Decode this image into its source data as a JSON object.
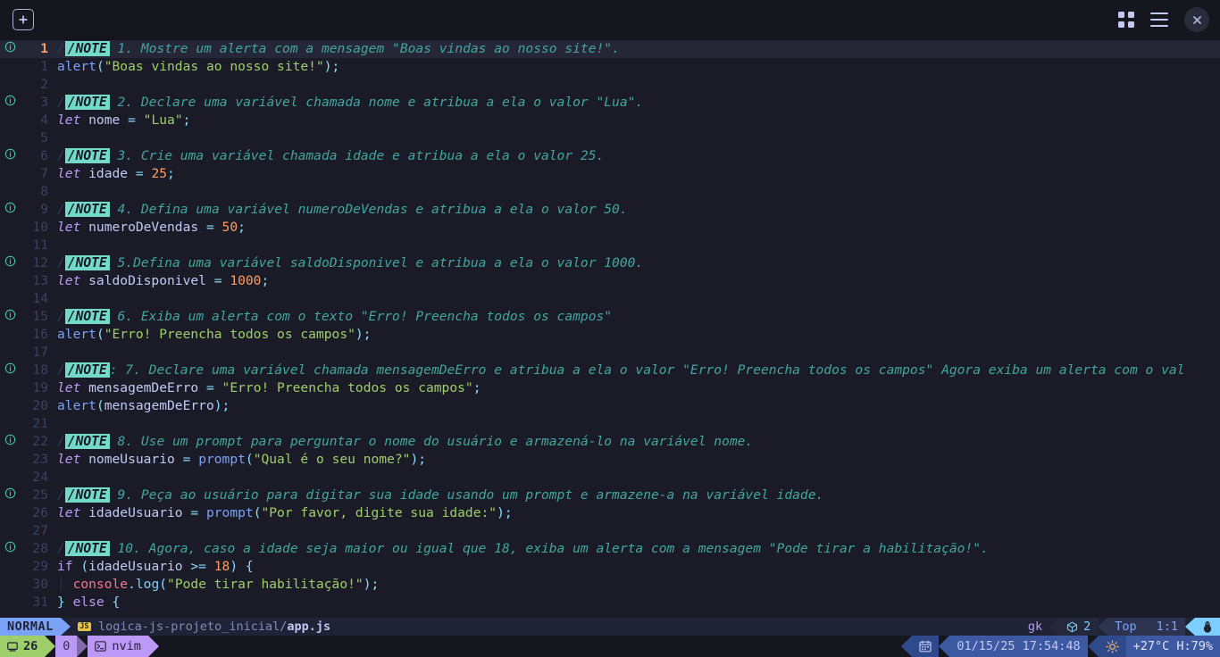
{
  "window": {
    "titlebar": {
      "new_tab_label": "+",
      "new_tab_icon": "plus-square-icon",
      "grid_icon": "grid-view-icon",
      "menu_icon": "hamburger-menu-icon",
      "close_icon": "close-x-icon"
    }
  },
  "editor": {
    "note_badge_label": "/NOTE",
    "cursor_line": 1,
    "lines": [
      {
        "num": "1",
        "sign": "info",
        "cursor": true,
        "tokens": [
          {
            "c": "t-note-slash",
            "t": "/"
          },
          {
            "c": "t-note-badge",
            "t": "/NOTE"
          },
          {
            "c": "t-comment",
            "t": " 1. Mostre um alerta com a mensagem \"Boas vindas ao nosso site!\"."
          }
        ]
      },
      {
        "num": "1",
        "sign": "",
        "cursor": false,
        "tokens": [
          {
            "c": "t-fn",
            "t": "alert"
          },
          {
            "c": "t-punct",
            "t": "("
          },
          {
            "c": "t-str",
            "t": "\"Boas vindas ao nosso site!\""
          },
          {
            "c": "t-punct",
            "t": ");"
          }
        ]
      },
      {
        "num": "2",
        "sign": "",
        "cursor": false,
        "tokens": []
      },
      {
        "num": "3",
        "sign": "info",
        "cursor": false,
        "tokens": [
          {
            "c": "t-note-slash",
            "t": "/"
          },
          {
            "c": "t-note-badge",
            "t": "/NOTE"
          },
          {
            "c": "t-comment",
            "t": " 2. Declare uma variável chamada nome e atribua a ela o valor \"Lua\"."
          }
        ]
      },
      {
        "num": "4",
        "sign": "",
        "cursor": false,
        "tokens": [
          {
            "c": "t-kw",
            "t": "let"
          },
          {
            "c": "t-ident",
            "t": " nome "
          },
          {
            "c": "t-op",
            "t": "="
          },
          {
            "c": "t-ident",
            "t": " "
          },
          {
            "c": "t-str",
            "t": "\"Lua\""
          },
          {
            "c": "t-punct",
            "t": ";"
          }
        ]
      },
      {
        "num": "5",
        "sign": "",
        "cursor": false,
        "tokens": []
      },
      {
        "num": "6",
        "sign": "info",
        "cursor": false,
        "tokens": [
          {
            "c": "t-note-slash",
            "t": "/"
          },
          {
            "c": "t-note-badge",
            "t": "/NOTE"
          },
          {
            "c": "t-comment",
            "t": " 3. Crie uma variável chamada idade e atribua a ela o valor 25."
          }
        ]
      },
      {
        "num": "7",
        "sign": "",
        "cursor": false,
        "tokens": [
          {
            "c": "t-kw",
            "t": "let"
          },
          {
            "c": "t-ident",
            "t": " idade "
          },
          {
            "c": "t-op",
            "t": "="
          },
          {
            "c": "t-ident",
            "t": " "
          },
          {
            "c": "t-num",
            "t": "25"
          },
          {
            "c": "t-punct",
            "t": ";"
          }
        ]
      },
      {
        "num": "8",
        "sign": "",
        "cursor": false,
        "tokens": []
      },
      {
        "num": "9",
        "sign": "info",
        "cursor": false,
        "tokens": [
          {
            "c": "t-note-slash",
            "t": "/"
          },
          {
            "c": "t-note-badge",
            "t": "/NOTE"
          },
          {
            "c": "t-comment",
            "t": " 4. Defina uma variável numeroDeVendas e atribua a ela o valor 50."
          }
        ]
      },
      {
        "num": "10",
        "sign": "",
        "cursor": false,
        "tokens": [
          {
            "c": "t-kw",
            "t": "let"
          },
          {
            "c": "t-ident",
            "t": " numeroDeVendas "
          },
          {
            "c": "t-op",
            "t": "="
          },
          {
            "c": "t-ident",
            "t": " "
          },
          {
            "c": "t-num",
            "t": "50"
          },
          {
            "c": "t-punct",
            "t": ";"
          }
        ]
      },
      {
        "num": "11",
        "sign": "",
        "cursor": false,
        "tokens": []
      },
      {
        "num": "12",
        "sign": "info",
        "cursor": false,
        "tokens": [
          {
            "c": "t-note-slash",
            "t": "/"
          },
          {
            "c": "t-note-badge",
            "t": "/NOTE"
          },
          {
            "c": "t-comment",
            "t": " 5.Defina uma variável saldoDisponivel e atribua a ela o valor 1000."
          }
        ]
      },
      {
        "num": "13",
        "sign": "",
        "cursor": false,
        "tokens": [
          {
            "c": "t-kw",
            "t": "let"
          },
          {
            "c": "t-ident",
            "t": " saldoDisponivel "
          },
          {
            "c": "t-op",
            "t": "="
          },
          {
            "c": "t-ident",
            "t": " "
          },
          {
            "c": "t-num",
            "t": "1000"
          },
          {
            "c": "t-punct",
            "t": ";"
          }
        ]
      },
      {
        "num": "14",
        "sign": "",
        "cursor": false,
        "tokens": []
      },
      {
        "num": "15",
        "sign": "info",
        "cursor": false,
        "tokens": [
          {
            "c": "t-note-slash",
            "t": "/"
          },
          {
            "c": "t-note-badge",
            "t": "/NOTE"
          },
          {
            "c": "t-comment",
            "t": " 6. Exiba um alerta com o texto \"Erro! Preencha todos os campos\""
          }
        ]
      },
      {
        "num": "16",
        "sign": "",
        "cursor": false,
        "tokens": [
          {
            "c": "t-fn",
            "t": "alert"
          },
          {
            "c": "t-punct",
            "t": "("
          },
          {
            "c": "t-str",
            "t": "\"Erro! Preencha todos os campos\""
          },
          {
            "c": "t-punct",
            "t": ");"
          }
        ]
      },
      {
        "num": "17",
        "sign": "",
        "cursor": false,
        "tokens": []
      },
      {
        "num": "18",
        "sign": "info",
        "cursor": false,
        "tokens": [
          {
            "c": "t-note-slash",
            "t": "/"
          },
          {
            "c": "t-note-badge",
            "t": "/NOTE"
          },
          {
            "c": "t-comment",
            "t": ": 7. Declare uma variável chamada mensagemDeErro e atribua a ela o valor \"Erro! Preencha todos os campos\" Agora exiba um alerta com o val"
          }
        ]
      },
      {
        "num": "19",
        "sign": "",
        "cursor": false,
        "tokens": [
          {
            "c": "t-kw",
            "t": "let"
          },
          {
            "c": "t-ident",
            "t": " mensagemDeErro "
          },
          {
            "c": "t-op",
            "t": "="
          },
          {
            "c": "t-ident",
            "t": " "
          },
          {
            "c": "t-str",
            "t": "\"Erro! Preencha todos os campos\""
          },
          {
            "c": "t-punct",
            "t": ";"
          }
        ]
      },
      {
        "num": "20",
        "sign": "",
        "cursor": false,
        "tokens": [
          {
            "c": "t-fn",
            "t": "alert"
          },
          {
            "c": "t-punct",
            "t": "("
          },
          {
            "c": "t-ident",
            "t": "mensagemDeErro"
          },
          {
            "c": "t-punct",
            "t": ");"
          }
        ]
      },
      {
        "num": "21",
        "sign": "",
        "cursor": false,
        "tokens": []
      },
      {
        "num": "22",
        "sign": "info",
        "cursor": false,
        "tokens": [
          {
            "c": "t-note-slash",
            "t": "/"
          },
          {
            "c": "t-note-badge",
            "t": "/NOTE"
          },
          {
            "c": "t-comment",
            "t": " 8. Use um prompt para perguntar o nome do usuário e armazená-lo na variável nome."
          }
        ]
      },
      {
        "num": "23",
        "sign": "",
        "cursor": false,
        "tokens": [
          {
            "c": "t-kw",
            "t": "let"
          },
          {
            "c": "t-ident",
            "t": " nomeUsuario "
          },
          {
            "c": "t-op",
            "t": "="
          },
          {
            "c": "t-ident",
            "t": " "
          },
          {
            "c": "t-fn",
            "t": "prompt"
          },
          {
            "c": "t-punct",
            "t": "("
          },
          {
            "c": "t-str",
            "t": "\"Qual é o seu nome?\""
          },
          {
            "c": "t-punct",
            "t": ");"
          }
        ]
      },
      {
        "num": "24",
        "sign": "",
        "cursor": false,
        "tokens": []
      },
      {
        "num": "25",
        "sign": "info",
        "cursor": false,
        "tokens": [
          {
            "c": "t-note-slash",
            "t": "/"
          },
          {
            "c": "t-note-badge",
            "t": "/NOTE"
          },
          {
            "c": "t-comment",
            "t": " 9. Peça ao usuário para digitar sua idade usando um prompt e armazene-a na variável idade."
          }
        ]
      },
      {
        "num": "26",
        "sign": "",
        "cursor": false,
        "tokens": [
          {
            "c": "t-kw",
            "t": "let"
          },
          {
            "c": "t-ident",
            "t": " idadeUsuario "
          },
          {
            "c": "t-op",
            "t": "="
          },
          {
            "c": "t-ident",
            "t": " "
          },
          {
            "c": "t-fn",
            "t": "prompt"
          },
          {
            "c": "t-punct",
            "t": "("
          },
          {
            "c": "t-str",
            "t": "\"Por favor, digite sua idade:\""
          },
          {
            "c": "t-punct",
            "t": ");"
          }
        ]
      },
      {
        "num": "27",
        "sign": "",
        "cursor": false,
        "tokens": []
      },
      {
        "num": "28",
        "sign": "info",
        "cursor": false,
        "tokens": [
          {
            "c": "t-note-slash",
            "t": "/"
          },
          {
            "c": "t-note-badge",
            "t": "/NOTE"
          },
          {
            "c": "t-comment",
            "t": " 10. Agora, caso a idade seja maior ou igual que 18, exiba um alerta com a mensagem \"Pode tirar a habilitação!\"."
          }
        ]
      },
      {
        "num": "29",
        "sign": "",
        "cursor": false,
        "tokens": [
          {
            "c": "t-kw2",
            "t": "if"
          },
          {
            "c": "t-punct",
            "t": " ("
          },
          {
            "c": "t-ident",
            "t": "idadeUsuario "
          },
          {
            "c": "t-op",
            "t": ">="
          },
          {
            "c": "t-ident",
            "t": " "
          },
          {
            "c": "t-num",
            "t": "18"
          },
          {
            "c": "t-punct",
            "t": ") {"
          }
        ]
      },
      {
        "num": "30",
        "sign": "",
        "cursor": false,
        "tokens": [
          {
            "c": "t-guide",
            "t": "│ "
          },
          {
            "c": "t-obj",
            "t": "console"
          },
          {
            "c": "t-punct",
            "t": "."
          },
          {
            "c": "t-prop",
            "t": "log"
          },
          {
            "c": "t-punct",
            "t": "("
          },
          {
            "c": "t-str",
            "t": "\"Pode tirar habilitação!\""
          },
          {
            "c": "t-punct",
            "t": ");"
          }
        ]
      },
      {
        "num": "31",
        "sign": "",
        "cursor": false,
        "tokens": [
          {
            "c": "t-punct",
            "t": "} "
          },
          {
            "c": "t-kw2",
            "t": "else"
          },
          {
            "c": "t-punct",
            "t": " {"
          }
        ]
      }
    ]
  },
  "statusline": {
    "mode": "NORMAL",
    "filetype_badge": "JS",
    "file_dir": "logica-js-projeto_inicial/",
    "file_name": "app.js",
    "keys_pending": "gk",
    "git_icon": "cube-icon",
    "git_count": "2",
    "scroll_position": "Top",
    "cursor_position": "1:1",
    "os_icon": "linux-penguin-icon"
  },
  "taskbar": {
    "lines_icon": "buffer-icon",
    "lines_count": "26",
    "zero_badge": "0",
    "terminal_icon": "terminal-icon",
    "process_name": "nvim",
    "calendar_icon": "calendar-icon",
    "datetime": "01/15/25 17:54:48",
    "weather_icon": "sun-icon",
    "weather": "+27°C H:79%"
  },
  "colors": {
    "background": "#1a1b26",
    "cursorline": "#252636",
    "note_badge": "#73daca",
    "accent_blue": "#7aa2f7",
    "accent_green": "#9ece6a",
    "accent_purple": "#bb9af7",
    "accent_orange": "#ff9e64"
  }
}
